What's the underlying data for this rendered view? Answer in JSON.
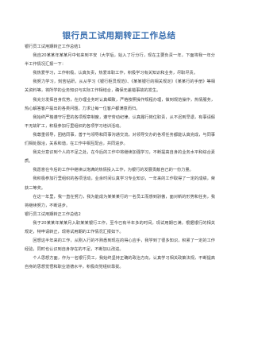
{
  "document": {
    "title": "银行员工试用期转正工作总结",
    "paragraphs": [
      {
        "type": "heading",
        "text": "银行员工试用期转正工作总结1"
      },
      {
        "type": "body",
        "text": "我自20某某年某某月中旬来到平安（大学后，始入了行分行，现在主要负责一年，下面将我一年分半工作情况汇报一下："
      },
      {
        "type": "body",
        "text": "我热爱学习，工作积极，认真负责，热爱本职工作，积极学习有关知识和业务，尽职尽责。"
      },
      {
        "type": "body",
        "text": "我努力学习，刻苦钻研，从从学习《银行柜员规范》、《某某银行的相关规定》《某某行的手册》等相关资料等，将所学的业务知识与实际工作相结合，确保无差错事故的发生。"
      },
      {
        "type": "body",
        "text": "我充分发挥自身优势，在办理业务时认真细致，严格按照操作规程办理，做到规范操作，热情服务，热心解答客户提出的各类问题，力求让每一位客户都满意而归。"
      },
      {
        "type": "body",
        "text": "我始终严格遵守行里的各项规章制度，遵守劳动纪律，认真履行岗位职责，从不迟到早退，有事请假不无故旷工，积极参加行里组织的各项学习培训活动。"
      },
      {
        "type": "body",
        "text": "我尊重领导，团结同事，善于与领导和同事沟通交流，对领导交办的各项任务都能认真完成，与同事们相处融洽，关系和谐，在工作中相互配合，共同进步。"
      },
      {
        "type": "body",
        "text": "我充分意识到个人的不足之处，在今后的工作中将继续加强学习，不断提高自身的业务水平和综合素质。"
      },
      {
        "type": "body",
        "text": "我愿意在今后的工作中继续以饱满的热情投入工作，为银行的发展贡献自己的一份力量。"
      },
      {
        "type": "body",
        "text": "我积极参加行里组织的各项活动，业余时间认真学习专业知识，一年来的工作取得了一定的成绩，荣获二等奖。"
      },
      {
        "type": "body",
        "text": "在这一年里，我一直在努力，我为能成为某某某行的一名员工而感到骄傲，面对新的形势和任务，我将继续努力，不断进步。"
      },
      {
        "type": "heading",
        "text": "银行员工试用期转正工作总结2"
      },
      {
        "type": "body",
        "text": "我于20某某年某某月入职某某银行工作，至今已有半年多的时间，现试用期已满，根据银行的相关规定，特申请转正，现将试用期的工作情况汇报如下。"
      },
      {
        "type": "body",
        "text": "回想这半年来的工作，从刚入行的不熟悉到现在的得心应手，我学到了很多知识，积累了一定的工作经验，同时也认识到自身存在的不足，不断加以改进。"
      },
      {
        "type": "body",
        "text": "个人思想方面，作为一名银行员工，我始终坚持正确的政治方向，认真学习相关政策法规，不断提高自身的思想觉悟和职业道德水平，积极向党组织靠拢。"
      }
    ]
  }
}
